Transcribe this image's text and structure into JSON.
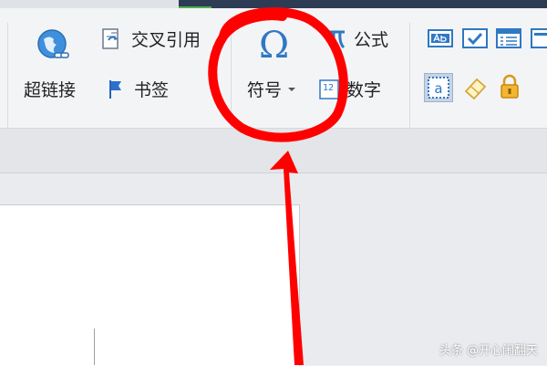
{
  "ribbon": {
    "hyperlink_label": "超链接",
    "cross_reference_label": "交叉引用",
    "bookmark_label": "书签",
    "symbol_label": "符号",
    "symbol_glyph": "Ω",
    "formula_label": "公式",
    "number_label": "数字",
    "number_icon_text": "12"
  },
  "icons": {
    "hyperlink": "globe-link-icon",
    "cross_reference": "cross-reference-icon",
    "bookmark": "flag-icon",
    "symbol": "omega-icon",
    "formula": "pi-icon",
    "number": "number-box-icon",
    "text_field": "text-field-icon",
    "checkbox": "checkbox-icon",
    "list_box": "list-box-icon",
    "more_controls": "controls-icon",
    "text_form": "text-form-icon",
    "eraser": "eraser-icon",
    "lock": "lock-icon"
  },
  "colors": {
    "annotation": "#ff0000",
    "ribbon_bg": "#f3f4f6",
    "accent_blue": "#2f78c4"
  },
  "watermark": "头条 @开心闹翻天"
}
